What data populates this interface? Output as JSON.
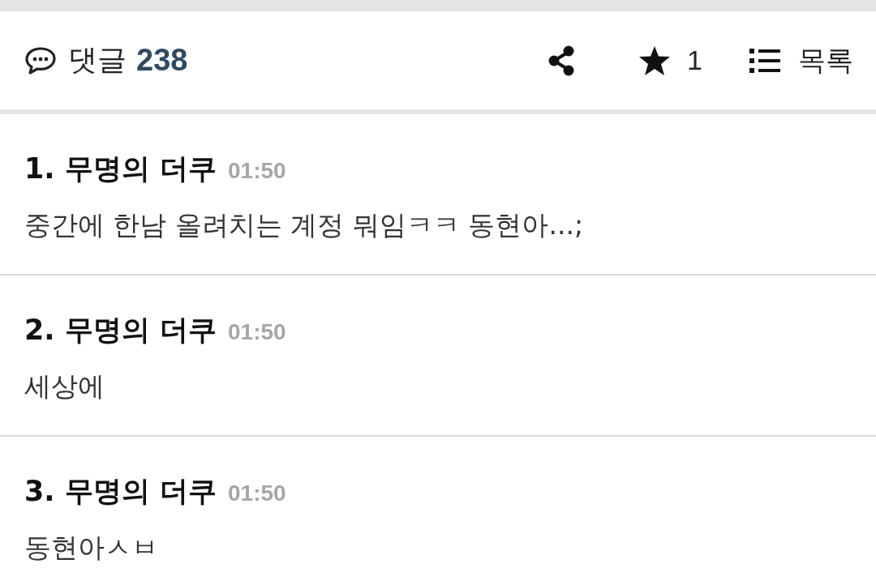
{
  "header": {
    "comments_label": "댓글",
    "comments_count": "238",
    "star_count": "1",
    "list_label": "목록"
  },
  "comments": [
    {
      "number": "1.",
      "author": "무명의 더쿠",
      "time": "01:50",
      "text": "중간에 한남 올려치는 계정 뭐임ㅋㅋ 동현아...;"
    },
    {
      "number": "2.",
      "author": "무명의 더쿠",
      "time": "01:50",
      "text": "세상에"
    },
    {
      "number": "3.",
      "author": "무명의 더쿠",
      "time": "01:50",
      "text": "동현아ㅅㅂ"
    }
  ]
}
